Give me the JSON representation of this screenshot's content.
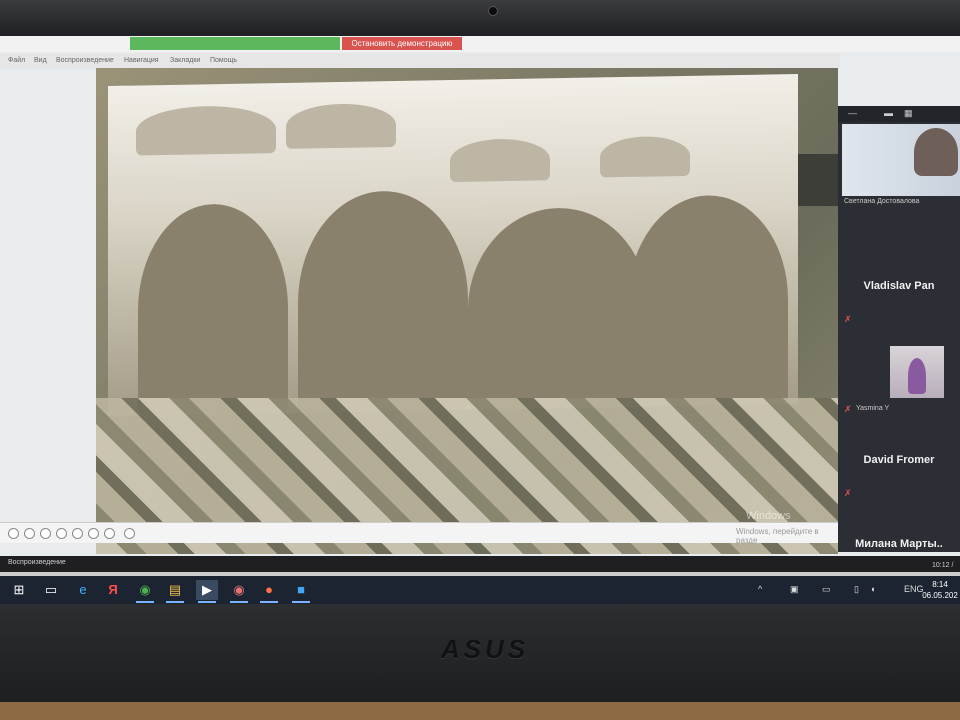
{
  "screen_share": {
    "green_label": "",
    "stop_label": "Остановить демонстрацию"
  },
  "menu": [
    "Файл",
    "Вид",
    "Воспроизведение",
    "Навигация",
    "Закладки",
    "Помощь"
  ],
  "player": {
    "status_label": "Воспроизведение",
    "time": "10:12 /"
  },
  "watermark": {
    "line1": "Windows",
    "line2": "Windows, перейдите в разде"
  },
  "participants": {
    "self": "Светлана Достовалова",
    "list": [
      {
        "name": "Vladislav Pan",
        "muted": true
      },
      {
        "name": "Yasmina Y",
        "muted": true
      },
      {
        "name": "David Fromer",
        "muted": true
      },
      {
        "name": "Милана  Марты..",
        "muted": false
      }
    ]
  },
  "taskbar": {
    "icons": [
      "windows-start-icon",
      "task-view-icon",
      "edge-icon",
      "yandex-icon",
      "chrome-icon",
      "files-icon",
      "video-player-icon",
      "chrome-alt-icon",
      "slides-icon",
      "zoom-icon"
    ],
    "language": "ENG",
    "time": "8:14",
    "date": "06.05.202"
  },
  "laptop": {
    "brand": "ASUS"
  }
}
